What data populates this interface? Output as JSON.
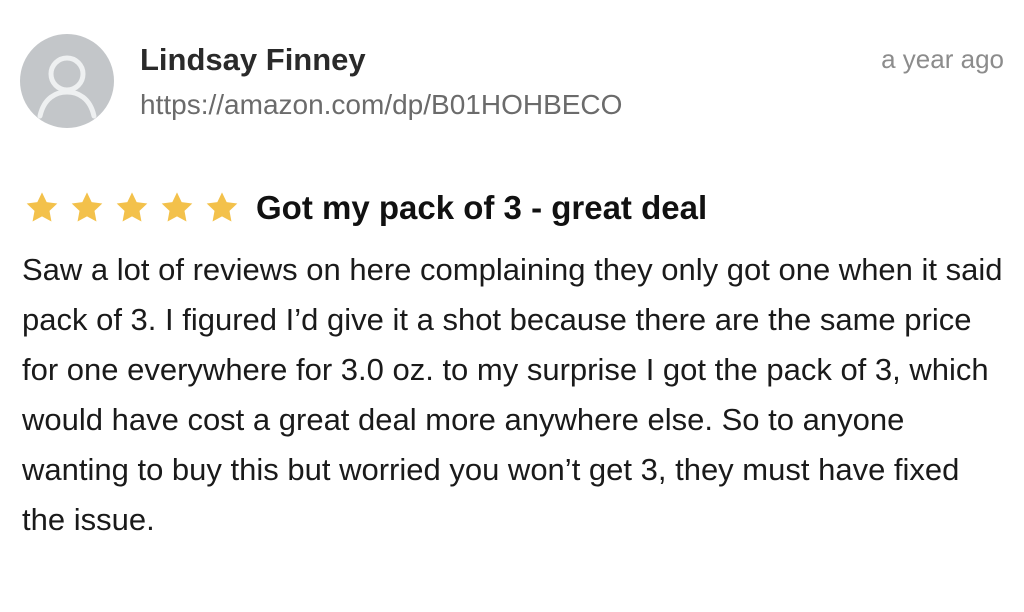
{
  "review": {
    "author": "Lindsay Finney",
    "source_url": "https://amazon.com/dp/B01HOHBECO",
    "timestamp": "a year ago",
    "rating": 5,
    "rating_max": 5,
    "title": "Got my pack of 3 - great deal",
    "body": "Saw a lot of reviews on here complaining they only got one when it said pack of 3. I figured I’d give it a shot because there are the same price for one everywhere for 3.0 oz. to my surprise I got the pack of 3, which would have cost a great deal more anywhere else. So to anyone wanting to buy this but worried you won’t get 3, they must have fixed the issue."
  },
  "icons": {
    "avatar": "user-silhouette-icon",
    "star": "star-icon"
  },
  "colors": {
    "star": "#f3c14b",
    "avatar_bg": "#c3c6c9",
    "avatar_fg": "#eef0f1",
    "muted_text": "#6b6b6b",
    "timestamp_text": "#8c8c8c"
  }
}
